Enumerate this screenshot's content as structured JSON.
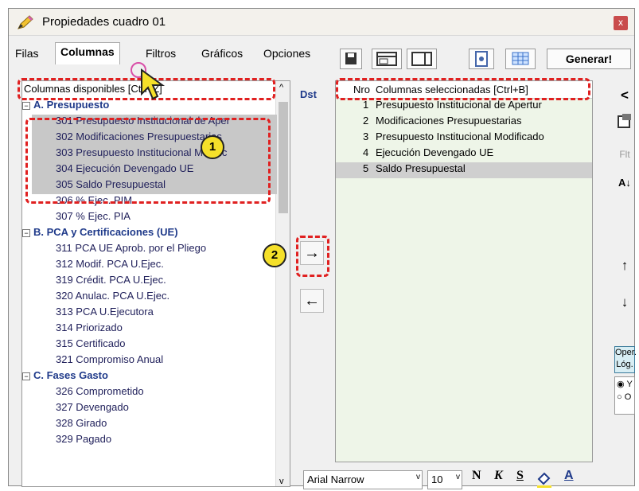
{
  "window": {
    "title": "Propiedades cuadro 01",
    "close": "x"
  },
  "tabs": [
    "Filas",
    "Columnas",
    "Filtros",
    "Gráficos",
    "Opciones"
  ],
  "toolbar": {
    "generate_label": "Generar!"
  },
  "left": {
    "header": "Columnas disponibles  [Ctrl+Z]",
    "groups": {
      "a": "A. Presupuesto",
      "b": "B. PCA y Certificaciones (UE)",
      "c": "C. Fases Gasto"
    },
    "a_items": [
      "301 Presupuesto Institucional de Aper",
      "302 Modificaciones Presupuestarias",
      "303 Presupuesto Institucional Modific",
      "304 Ejecución Devengado UE",
      "305 Saldo Presupuestal",
      "306 % Ejec. PIM",
      "307 % Ejec. PIA"
    ],
    "b_items": [
      "311 PCA UE Aprob. por el Pliego",
      "312 Modif. PCA U.Ejec.",
      "319 Crédit. PCA U.Ejec.",
      "320 Anulac. PCA U.Ejec.",
      "313 PCA U.Ejecutora",
      "314 Priorizado",
      "315 Certificado",
      "321 Compromiso Anual"
    ],
    "c_items": [
      "326 Comprometido",
      "327 Devengado",
      "328 Girado",
      "329 Pagado"
    ]
  },
  "middle": {
    "dst_label": "Dst",
    "add_arrow": "→",
    "remove_arrow": "←"
  },
  "right": {
    "col_nro": "Nro",
    "header": "Columnas seleccionadas  [Ctrl+B]",
    "rows": [
      {
        "nro": "1",
        "label": "Presupuesto Institucional de Apertur"
      },
      {
        "nro": "2",
        "label": "Modificaciones Presupuestarias"
      },
      {
        "nro": "3",
        "label": "Presupuesto Institucional Modificado"
      },
      {
        "nro": "4",
        "label": "Ejecución Devengado UE"
      },
      {
        "nro": "5",
        "label": "Saldo Presupuestal"
      }
    ]
  },
  "side": {
    "back_arrow": "<",
    "flt_label": "Flt",
    "sort_label": "A↓",
    "up_arrow": "↑",
    "down_arrow": "↓",
    "oper_label": "Oper. Lóg.",
    "opt_y": "Y",
    "opt_o": "O"
  },
  "bottom": {
    "font_name": "Arial Narrow",
    "font_size": "10",
    "bold": "N",
    "italic": "K",
    "strike": "S",
    "font_color_letter": "A"
  },
  "annotations": {
    "badge1": "1",
    "badge2": "2"
  }
}
